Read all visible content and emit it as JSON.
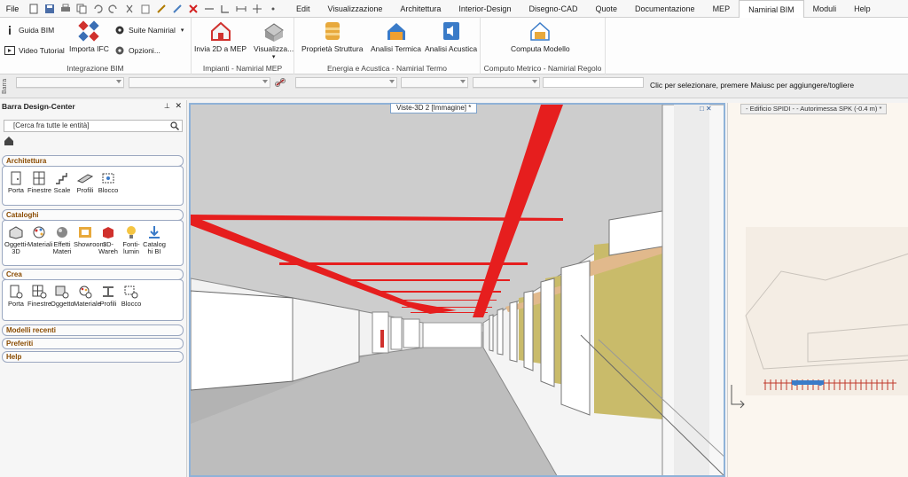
{
  "menu": {
    "file": "File",
    "tabs": [
      "Edit",
      "Visualizzazione",
      "Architettura",
      "Interior-Design",
      "Disegno-CAD",
      "Quote",
      "Documentazione",
      "MEP",
      "Namirial BIM",
      "Moduli",
      "Help"
    ],
    "active_tab": "Namirial BIM"
  },
  "ribbon": {
    "groups": {
      "integrazione": {
        "title": "Integrazione BIM",
        "guida": "Guida BIM",
        "video": "Video Tutorial",
        "importa": "Importa IFC",
        "suite": "Suite Namirial",
        "opzioni": "Opzioni..."
      },
      "impianti": {
        "title": "Impianti - Namirial MEP",
        "invia": "Invia 2D a MEP",
        "visualizza": "Visualizza..."
      },
      "energia": {
        "title": "Energia e Acustica - Namirial Termo",
        "strutt": "Proprietà Struttura",
        "termica": "Analisi Termica",
        "acustica": "Analisi Acustica"
      },
      "computo": {
        "title": "Computo Metrico - Namirial Regolo",
        "computa": "Computa Modello"
      }
    }
  },
  "propbar": {
    "label": "Barra",
    "hint": "Clic per selezionare, premere Maiusc per aggiungere/togliere"
  },
  "left_panel": {
    "title": "Barra Design-Center",
    "search_text": "[Cerca fra tutte le entità]",
    "sections": {
      "architettura": {
        "title": "Architettura",
        "items": [
          "Porta",
          "Finestre",
          "Scale",
          "Profili",
          "Blocco"
        ]
      },
      "cataloghi": {
        "title": "Cataloghi",
        "items": [
          "Oggetti-3D",
          "Materiali",
          "Effetti Materi",
          "Showroom",
          "3D-Wareh",
          "Fonti-lumin",
          "Catalog hi BI"
        ]
      },
      "crea": {
        "title": "Crea",
        "items": [
          "Porta",
          "Finestre",
          "Oggetto",
          "Materiale",
          "Profili",
          "Blocco"
        ]
      },
      "modelli": "Modelli recenti",
      "preferiti": "Preferiti",
      "help": "Help"
    }
  },
  "viewport": {
    "tab": "Viste-3D 2 [Immagine] *"
  },
  "right_panel": {
    "tab": "- Edificio SPIDI - - Autorimessa SPK (-0.4 m) *"
  }
}
